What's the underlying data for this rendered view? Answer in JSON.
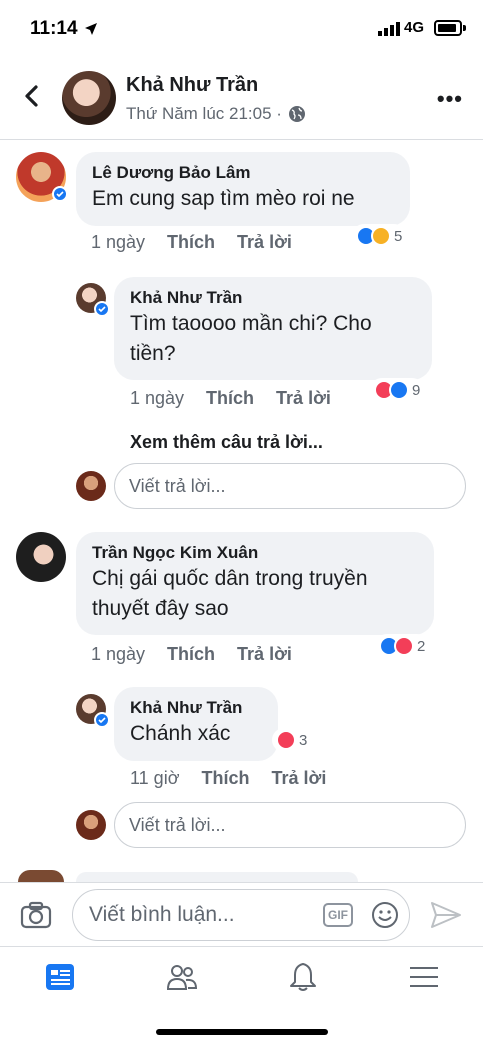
{
  "status_bar": {
    "time": "11:14",
    "network": "4G"
  },
  "header": {
    "name": "Khả Như Trần",
    "subtitle": "Thứ Năm lúc 21:05 ·"
  },
  "comments": [
    {
      "author": "Lê Dương Bảo Lâm",
      "text": "Em cung sap tìm mèo roi ne",
      "time": "1 ngày",
      "like_label": "Thích",
      "reply_label": "Trả lời",
      "reaction_count": "5",
      "reactions": [
        "like",
        "haha"
      ],
      "replies": [
        {
          "author": "Khả Như Trần",
          "text_line1": "Tìm taoooo mần chi? Cho",
          "text_line2": "tiền?",
          "time": "1 ngày",
          "like_label": "Thích",
          "reply_label": "Trả lời",
          "reaction_count": "9",
          "reactions": [
            "love",
            "like"
          ]
        }
      ],
      "more_replies": "Xem thêm câu trả lời...",
      "reply_placeholder": "Viết trả lời..."
    },
    {
      "author": "Trần Ngọc Kim Xuân",
      "text_line1": "Chị gái quốc dân trong truyền",
      "text_line2": "thuyết đây sao",
      "time": "1 ngày",
      "like_label": "Thích",
      "reply_label": "Trả lời",
      "reaction_count": "2",
      "reactions": [
        "like",
        "love"
      ],
      "replies": [
        {
          "author": "Khả Như Trần",
          "text": "Chánh xác",
          "time": "11 giờ",
          "like_label": "Thích",
          "reply_label": "Trả lời",
          "reaction_count": "3",
          "reactions": [
            "love"
          ]
        }
      ],
      "reply_placeholder": "Viết trả lời..."
    }
  ],
  "composer": {
    "placeholder": "Viết bình luận...",
    "gif_label": "GIF"
  },
  "icons": {
    "back": "back-chevron-icon",
    "globe": "globe-icon",
    "more": "more-dots-icon",
    "camera": "camera-icon",
    "emoji": "emoji-icon",
    "send": "send-icon",
    "tabs": [
      "news-feed-icon",
      "friends-icon",
      "notifications-icon",
      "menu-icon"
    ]
  },
  "colors": {
    "accent": "#1877f2",
    "love": "#f33e58",
    "haha": "#f7b125",
    "bubble": "#f0f2f5"
  }
}
